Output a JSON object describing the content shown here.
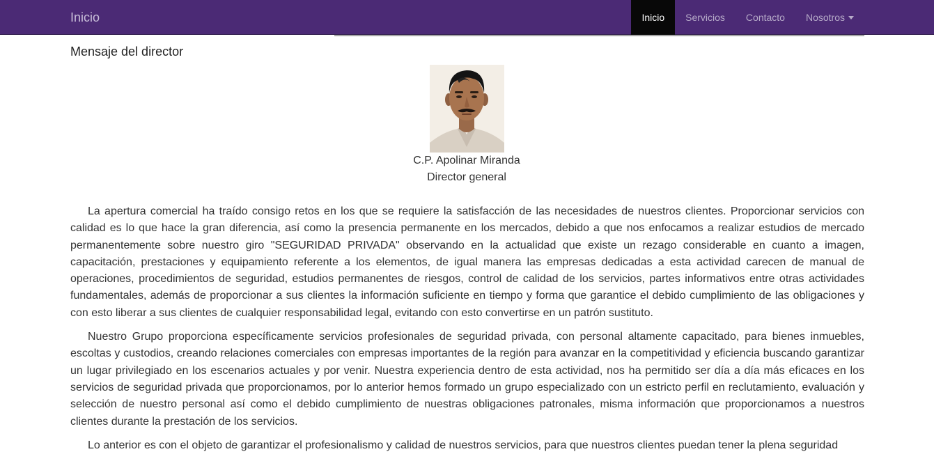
{
  "navbar": {
    "brand": "Inicio",
    "items": [
      {
        "label": "Inicio",
        "active": true
      },
      {
        "label": "Servicios",
        "active": false
      },
      {
        "label": "Contacto",
        "active": false
      },
      {
        "label": "Nosotros",
        "active": false,
        "dropdown": true
      }
    ],
    "colors": {
      "background": "#4b2a75",
      "active_background": "#080808"
    }
  },
  "page": {
    "title": "Mensaje del director",
    "director_name": "C.P. Apolinar Miranda",
    "director_role": "Director general",
    "paragraphs": [
      "La apertura comercial ha traído consigo retos en los que se requiere la satisfacción de las necesidades de nuestros clientes. Proporcionar servicios con calidad es lo que hace la gran diferencia, así como la presencia permanente en los mercados, debido a que nos enfocamos a realizar estudios de mercado permanentemente sobre nuestro giro \"SEGURIDAD PRIVADA\" observando en la actualidad que existe un rezago considerable en cuanto a imagen, capacitación, prestaciones y equipamiento referente a los elementos, de igual manera las empresas dedicadas a esta actividad carecen de manual de operaciones, procedimientos de seguridad, estudios permanentes de riesgos, control de calidad de los servicios, partes informativos entre otras actividades fundamentales, además de proporcionar a sus clientes la información suficiente en tiempo y forma que garantice el debido cumplimiento de las obligaciones y con esto liberar a sus clientes de cualquier responsabilidad legal, evitando con esto convertirse en un patrón sustituto.",
      "Nuestro Grupo proporciona específicamente servicios profesionales de seguridad privada, con personal altamente capacitado, para bienes inmuebles, escoltas y custodios, creando relaciones comerciales con empresas importantes de la región para avanzar en la competitividad y eficiencia buscando garantizar un lugar privilegiado en los escenarios actuales y por venir. Nuestra experiencia dentro de esta actividad, nos ha permitido ser día a día más eficaces en los servicios de seguridad privada que proporcionamos, por lo anterior hemos formado un grupo especializado con un estricto perfil en reclutamiento, evaluación y selección de nuestro personal así como el debido cumplimiento de nuestras obligaciones patronales, misma información que proporcionamos a nuestros clientes durante la prestación de los servicios.",
      "Lo anterior es con el objeto de garantizar el profesionalismo y calidad de nuestros servicios, para que nuestros clientes puedan tener la plena seguridad"
    ]
  }
}
